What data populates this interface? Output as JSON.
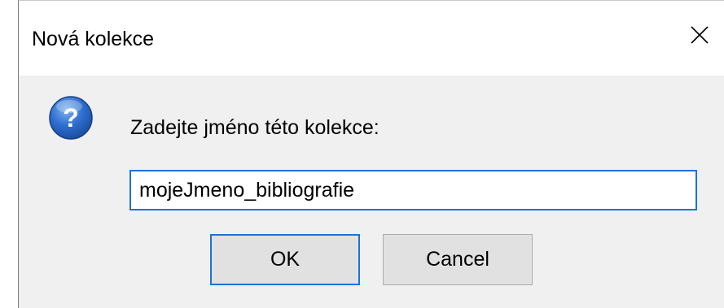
{
  "window": {
    "title": "Nová kolekce",
    "close_icon": "close-icon"
  },
  "dialog": {
    "icon": "question-icon",
    "prompt": "Zadejte jméno této kolekce:",
    "input_value": "mojeJmeno_bibliografie"
  },
  "buttons": {
    "ok_label": "OK",
    "cancel_label": "Cancel"
  },
  "colors": {
    "focus_border": "#1a73d9",
    "dialog_background": "#f0f0f0",
    "button_background": "#e1e1e1"
  }
}
